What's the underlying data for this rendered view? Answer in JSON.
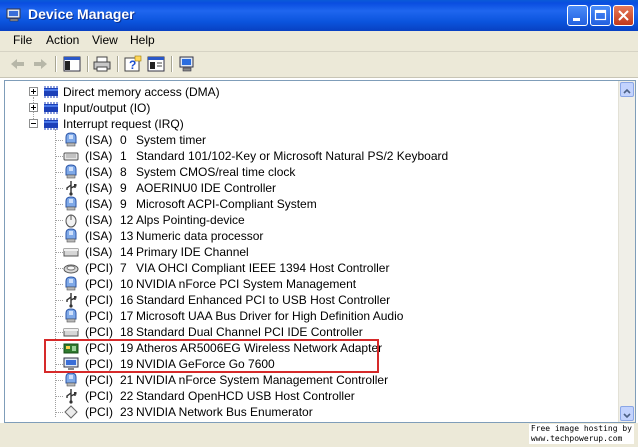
{
  "window": {
    "title": "Device Manager"
  },
  "menu": [
    "File",
    "Action",
    "View",
    "Help"
  ],
  "toolbar": [
    "back-icon",
    "forward-icon",
    "show-hide-tree-icon",
    "print-icon",
    "help-icon",
    "properties-icon",
    "scan-hardware-icon"
  ],
  "tree": {
    "collapsed_categories": [
      {
        "label": "Direct memory access (DMA)"
      },
      {
        "label": "Input/output (IO)"
      }
    ],
    "expanded_category": {
      "label": "Interrupt request (IRQ)"
    },
    "devices": [
      {
        "bus": "(ISA)",
        "irq": "0",
        "name": "System timer",
        "icon": "system-device-icon"
      },
      {
        "bus": "(ISA)",
        "irq": "1",
        "name": "Standard 101/102-Key or Microsoft Natural PS/2 Keyboard",
        "icon": "keyboard-icon"
      },
      {
        "bus": "(ISA)",
        "irq": "8",
        "name": "System CMOS/real time clock",
        "icon": "system-device-icon"
      },
      {
        "bus": "(ISA)",
        "irq": "9",
        "name": "AOERINU0 IDE Controller",
        "icon": "usb-controller-icon"
      },
      {
        "bus": "(ISA)",
        "irq": "9",
        "name": "Microsoft ACPI-Compliant System",
        "icon": "system-device-icon"
      },
      {
        "bus": "(ISA)",
        "irq": "12",
        "name": "Alps Pointing-device",
        "icon": "mouse-icon"
      },
      {
        "bus": "(ISA)",
        "irq": "13",
        "name": "Numeric data processor",
        "icon": "system-device-icon"
      },
      {
        "bus": "(ISA)",
        "irq": "14",
        "name": "Primary IDE Channel",
        "icon": "ide-channel-icon"
      },
      {
        "bus": "(PCI)",
        "irq": "7",
        "name": "VIA OHCI Compliant IEEE 1394 Host Controller",
        "icon": "ieee1394-icon"
      },
      {
        "bus": "(PCI)",
        "irq": "10",
        "name": "NVIDIA nForce PCI System Management",
        "icon": "system-device-icon"
      },
      {
        "bus": "(PCI)",
        "irq": "16",
        "name": "Standard Enhanced PCI to USB Host Controller",
        "icon": "usb-controller-icon"
      },
      {
        "bus": "(PCI)",
        "irq": "17",
        "name": "Microsoft UAA Bus Driver for High Definition Audio",
        "icon": "system-device-icon"
      },
      {
        "bus": "(PCI)",
        "irq": "18",
        "name": "Standard Dual Channel PCI IDE Controller",
        "icon": "ide-channel-icon"
      },
      {
        "bus": "(PCI)",
        "irq": "19",
        "name": "Atheros AR5006EG Wireless Network Adapter",
        "icon": "network-adapter-icon"
      },
      {
        "bus": "(PCI)",
        "irq": "19",
        "name": "NVIDIA GeForce Go 7600",
        "icon": "display-adapter-icon"
      },
      {
        "bus": "(PCI)",
        "irq": "21",
        "name": "NVIDIA nForce System Management Controller",
        "icon": "system-device-icon"
      },
      {
        "bus": "(PCI)",
        "irq": "22",
        "name": "Standard OpenHCD USB Host Controller",
        "icon": "usb-controller-icon"
      },
      {
        "bus": "(PCI)",
        "irq": "23",
        "name": "NVIDIA Network Bus Enumerator",
        "icon": "network-enumerator-icon"
      }
    ]
  },
  "watermark": {
    "line1": "Free image hosting by",
    "line2": "www.techpowerup.com"
  },
  "colors": {
    "titlebar": "#0a4ee0",
    "highlight": "#d62a2a",
    "chrome": "#ece9d8"
  }
}
